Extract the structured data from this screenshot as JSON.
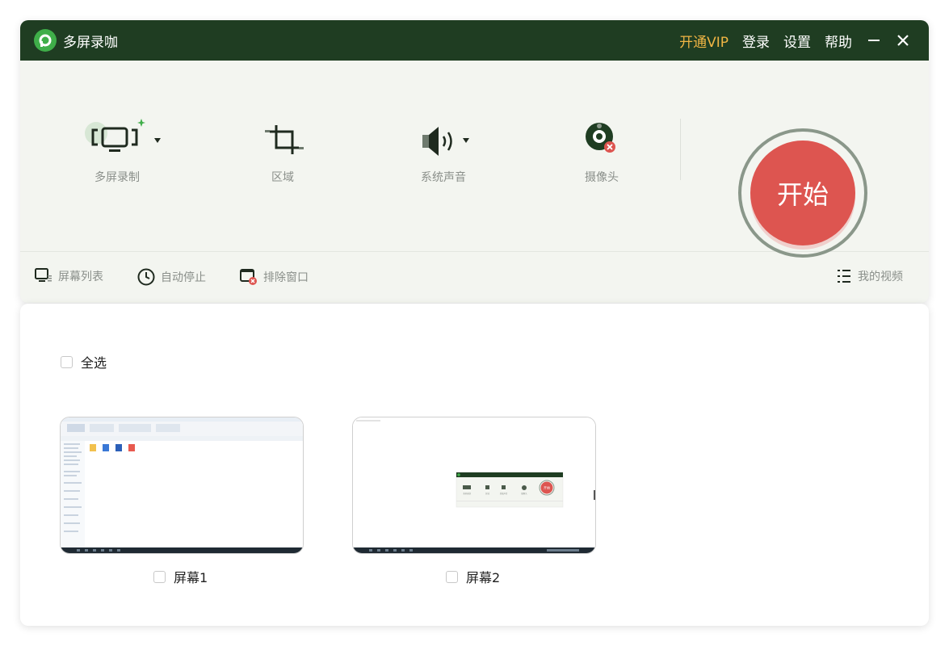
{
  "app": {
    "title": "多屏录咖",
    "brand_color": "#1f3d22",
    "accent_vip": "#f0b544",
    "start_color": "#dd5550"
  },
  "titlebar": {
    "vip": "开通VIP",
    "login": "登录",
    "settings": "设置",
    "help": "帮助",
    "minimize_icon": "minimize-icon",
    "close_icon": "close-icon"
  },
  "tools": [
    {
      "label": "多屏录制",
      "icon": "multi-screen-icon"
    },
    {
      "label": "区域",
      "icon": "crop-icon"
    },
    {
      "label": "系统声音",
      "icon": "speaker-icon"
    },
    {
      "label": "摄像头",
      "icon": "webcam-icon"
    }
  ],
  "start": {
    "label": "开始"
  },
  "bottombar": {
    "screen_list": "屏幕列表",
    "auto_stop": "自动停止",
    "exclude_window": "排除窗口",
    "my_videos": "我的视频"
  },
  "content": {
    "select_all": "全选",
    "screens": [
      {
        "label": "屏幕1"
      },
      {
        "label": "屏幕2"
      }
    ],
    "preview_app": {
      "tools": [
        "多屏录制",
        "区域",
        "系统声音",
        "摄像头"
      ],
      "start": "开始"
    }
  }
}
